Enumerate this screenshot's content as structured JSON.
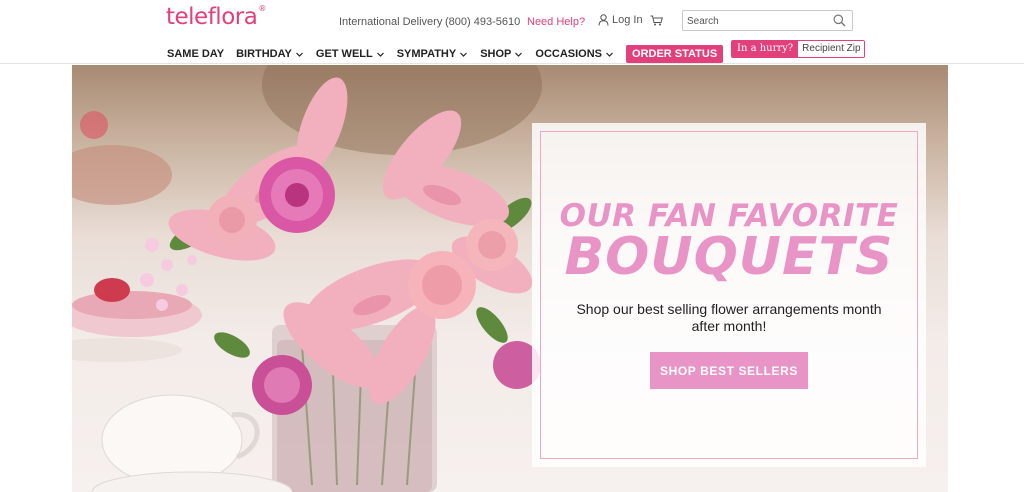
{
  "header": {
    "logo": "teleflora",
    "logo_mark": "®",
    "utility": {
      "international": "International Delivery",
      "phone": "(800) 493-5610",
      "help": "Need Help?",
      "login": "Log In"
    },
    "search": {
      "placeholder": "Search"
    },
    "nav": [
      {
        "label": "SAME DAY"
      },
      {
        "label": "BIRTHDAY"
      },
      {
        "label": "GET WELL"
      },
      {
        "label": "SYMPATHY"
      },
      {
        "label": "SHOP"
      },
      {
        "label": "OCCASIONS"
      }
    ],
    "order_status": "ORDER STATUS",
    "hurry": {
      "tag": "In a hurry?",
      "placeholder": "Recipient Zip"
    }
  },
  "hero": {
    "title_line1": "OUR FAN FAVORITE",
    "title_line2": "BOUQUETS",
    "subtitle": "Shop our best selling flower arrangements month after month!",
    "cta": "SHOP BEST SELLERS"
  },
  "colors": {
    "brand": "#e2407a",
    "promo_pink": "#e994c6"
  },
  "icons": [
    "user-icon",
    "cart-icon",
    "search-icon",
    "chevron-down-icon"
  ]
}
